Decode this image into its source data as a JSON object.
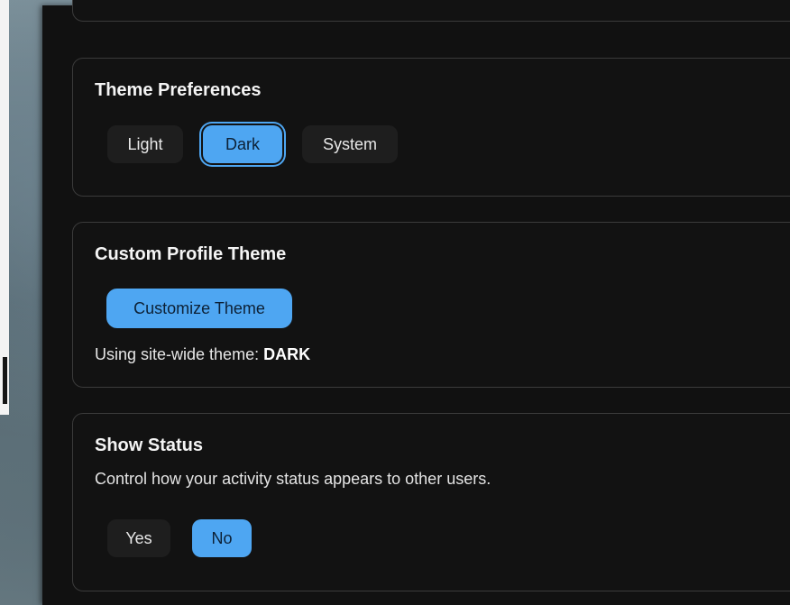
{
  "theme_preferences": {
    "title": "Theme Preferences",
    "options": [
      "Light",
      "Dark",
      "System"
    ],
    "selected": "Dark"
  },
  "custom_profile_theme": {
    "title": "Custom Profile Theme",
    "button_label": "Customize Theme",
    "status_prefix": "Using site-wide theme:",
    "status_value": "DARK"
  },
  "show_status": {
    "title": "Show Status",
    "description": "Control how your activity status appears to other users.",
    "options": [
      "Yes",
      "No"
    ],
    "selected": "No"
  },
  "colors": {
    "panel_background": "#111111",
    "card_border": "#3b3b3b",
    "accent": "#4ea6f2",
    "button_background": "#1e1e1e"
  }
}
